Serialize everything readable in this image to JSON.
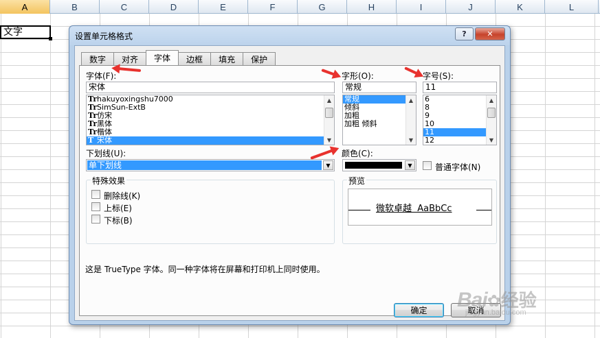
{
  "columns": [
    "A",
    "B",
    "C",
    "D",
    "E",
    "F",
    "G",
    "H",
    "I",
    "J",
    "K",
    "L"
  ],
  "cell_a1_value": "文字",
  "dialog": {
    "title": "设置单元格格式",
    "help_label": "?",
    "close_label": "✕",
    "tabs": [
      {
        "label": "数字"
      },
      {
        "label": "对齐"
      },
      {
        "label": "字体",
        "active": true
      },
      {
        "label": "边框"
      },
      {
        "label": "填充"
      },
      {
        "label": "保护"
      }
    ],
    "font": {
      "label": "字体(F):",
      "value": "宋体",
      "items": [
        {
          "label": "hakuyoxingshu7000",
          "icon": "Tr"
        },
        {
          "label": "SimSun-ExtB",
          "icon": "Tr"
        },
        {
          "label": "仿宋",
          "icon": "Tr"
        },
        {
          "label": "黑体",
          "icon": "Tr"
        },
        {
          "label": "楷体",
          "icon": "Tr"
        },
        {
          "label": "宋体",
          "icon": "T",
          "selected": true
        }
      ]
    },
    "style": {
      "label": "字形(O):",
      "value": "常规",
      "items": [
        {
          "label": "常规",
          "selected": true
        },
        {
          "label": "倾斜"
        },
        {
          "label": "加粗"
        },
        {
          "label": "加粗 倾斜"
        }
      ]
    },
    "size": {
      "label": "字号(S):",
      "value": "11",
      "items": [
        {
          "label": "6"
        },
        {
          "label": "8"
        },
        {
          "label": "9"
        },
        {
          "label": "10"
        },
        {
          "label": "11",
          "selected": true
        },
        {
          "label": "12"
        }
      ]
    },
    "underline": {
      "label": "下划线(U):",
      "value": "单下划线"
    },
    "color": {
      "label": "颜色(C):",
      "value_color": "#000000"
    },
    "normal_font": {
      "label": "普通字体(N)",
      "checked": false
    },
    "effects": {
      "title": "特殊效果",
      "strikethrough": "删除线(K)",
      "superscript": "上标(E)",
      "subscript": "下标(B)"
    },
    "preview": {
      "title": "预览",
      "text": "微软卓越  AaBbCc"
    },
    "info_text": "这是 TrueType 字体。同一种字体将在屏幕和打印机上同时使用。",
    "ok_label": "确定",
    "cancel_label": "取消"
  },
  "watermark": {
    "logo": "Bai",
    "logo_cn": "经验",
    "url": "jingyan.baidu.com"
  },
  "colors": {
    "selection": "#3399ff",
    "annotation_arrow": "#e8322e",
    "dialog_frame": "#b9d1ea"
  }
}
